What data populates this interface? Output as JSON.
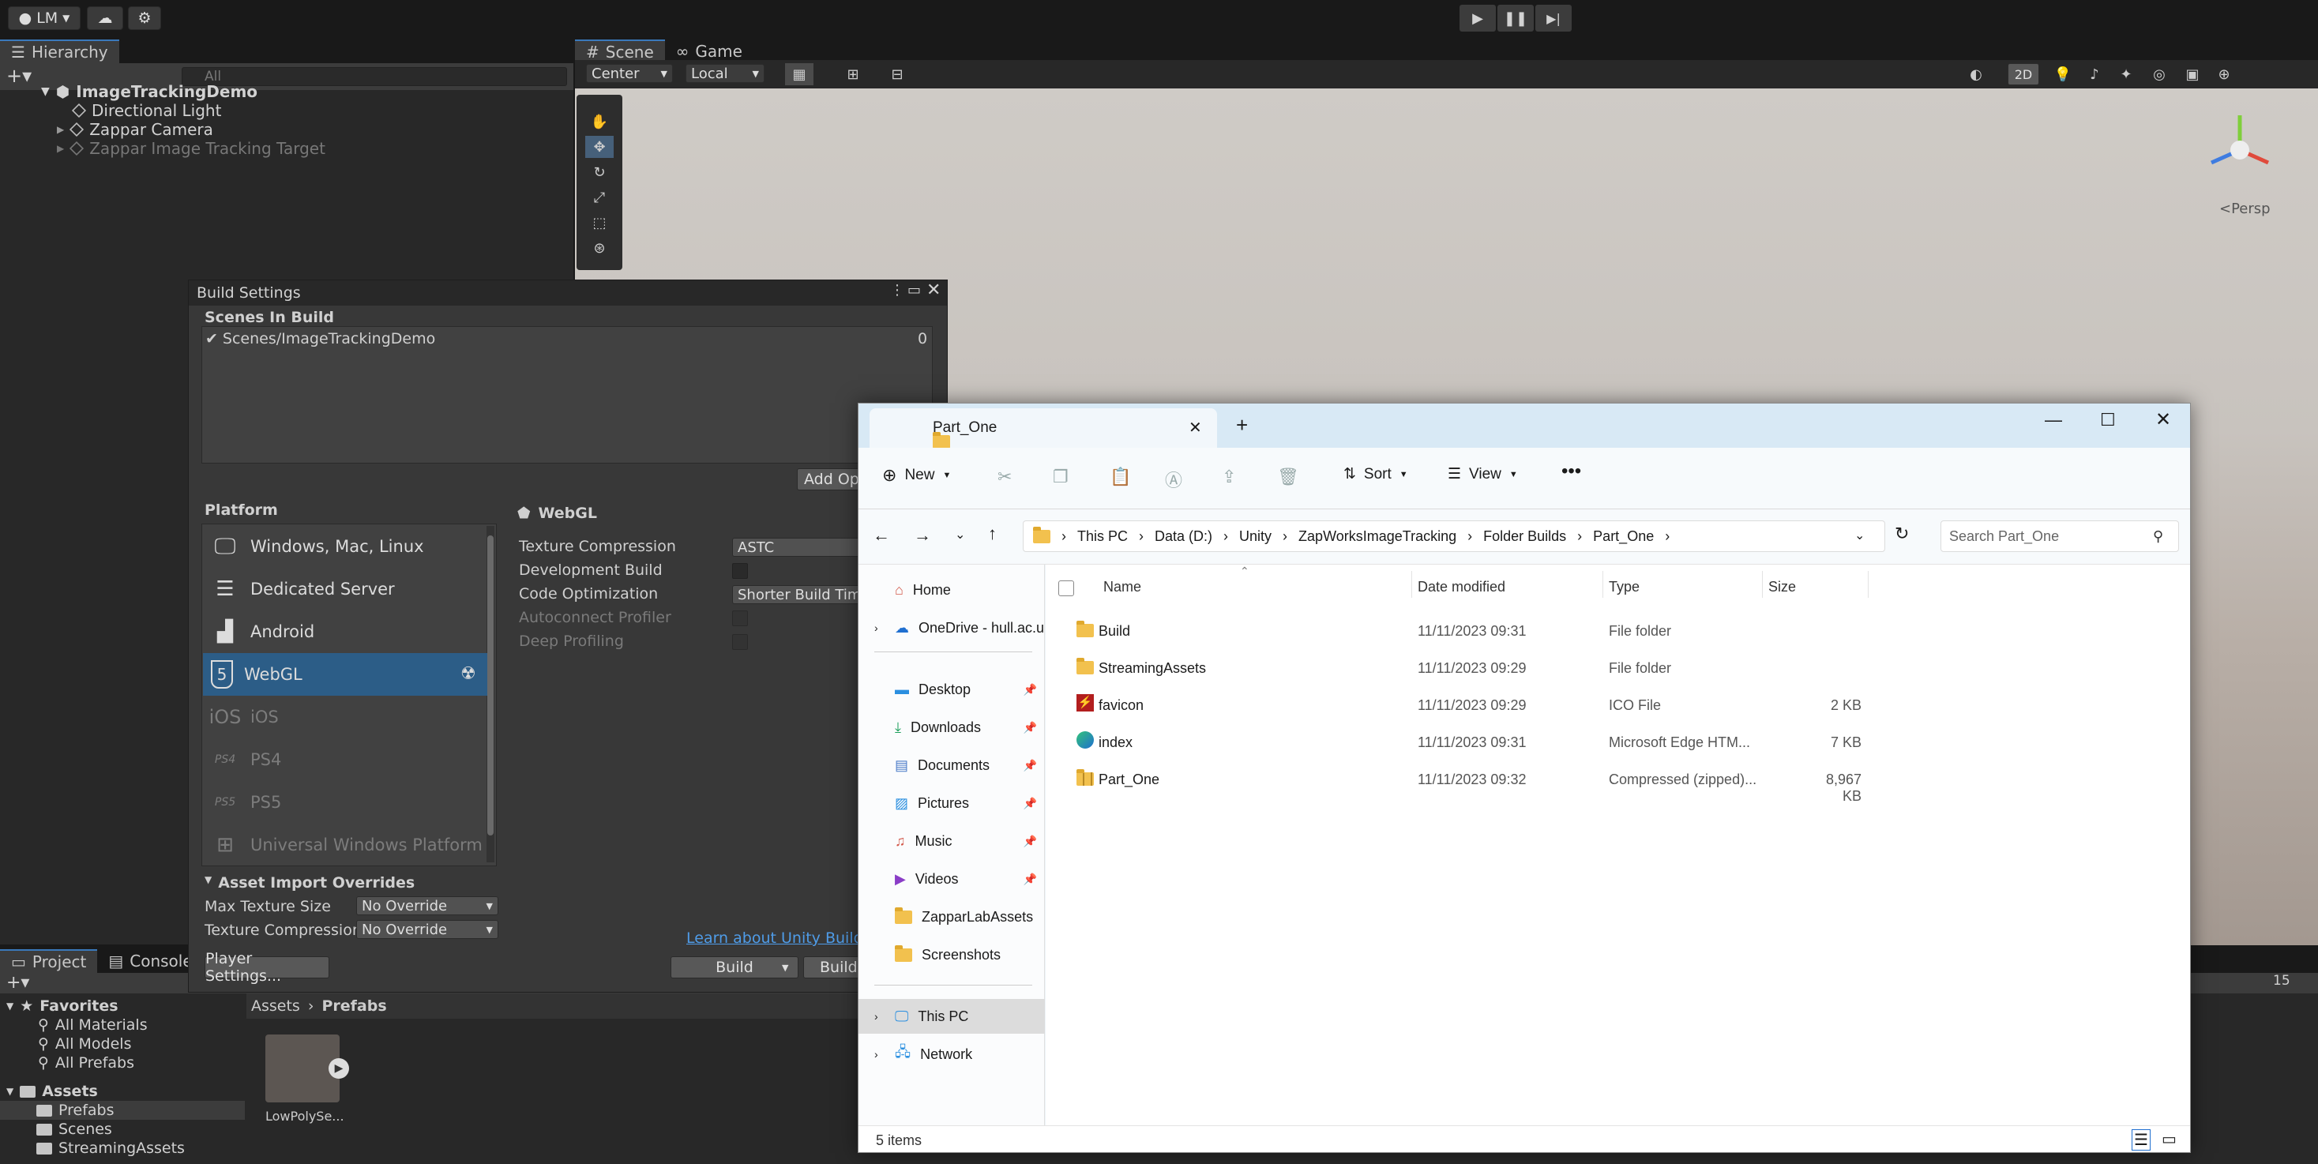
{
  "toolbar": {
    "account": "LM"
  },
  "hierarchy": {
    "tab": "Hierarchy",
    "search_placeholder": "All",
    "root": "ImageTrackingDemo",
    "items": [
      "Directional Light",
      "Zappar Camera",
      "Zappar Image Tracking Target"
    ]
  },
  "scene": {
    "tabs": [
      "Scene",
      "Game"
    ],
    "pivot": "Center",
    "space": "Local",
    "mode_2d": "2D",
    "persp": "<Persp"
  },
  "build_settings": {
    "title": "Build Settings",
    "scenes_header": "Scenes In Build",
    "scene_entry": "Scenes/ImageTrackingDemo",
    "scene_index": "0",
    "add_open": "Add Ope",
    "platform_header": "Platform",
    "platforms": [
      {
        "label": "Windows, Mac, Linux",
        "icon": "monitor-icon"
      },
      {
        "label": "Dedicated Server",
        "icon": "server-icon"
      },
      {
        "label": "Android",
        "icon": "android-icon"
      },
      {
        "label": "WebGL",
        "icon": "html5-icon"
      },
      {
        "label": "iOS",
        "icon": "ios-icon"
      },
      {
        "label": "PS4",
        "icon": "ps4-icon"
      },
      {
        "label": "PS5",
        "icon": "ps5-icon"
      },
      {
        "label": "Universal Windows Platform",
        "icon": "windows-icon"
      }
    ],
    "webgl_header": "WebGL",
    "settings": [
      {
        "label": "Texture Compression",
        "value": "ASTC"
      },
      {
        "label": "Development Build",
        "value": ""
      },
      {
        "label": "Code Optimization",
        "value": "Shorter Build Time"
      },
      {
        "label": "Autoconnect Profiler",
        "value": ""
      },
      {
        "label": "Deep Profiling",
        "value": ""
      }
    ],
    "overrides_header": "Asset Import Overrides",
    "max_texture_label": "Max Texture Size",
    "max_texture_value": "No Override",
    "tex_comp_label": "Texture Compression",
    "tex_comp_value": "No Override",
    "learn_link": "Learn about Unity Build A",
    "player_settings": "Player Settings...",
    "build": "Build",
    "build_and_run": "Build"
  },
  "project": {
    "tabs": [
      "Project",
      "Console"
    ],
    "favorites": "Favorites",
    "fav_items": [
      "All Materials",
      "All Models",
      "All Prefabs"
    ],
    "assets": "Assets",
    "asset_items": [
      "Prefabs",
      "Scenes",
      "StreamingAssets"
    ],
    "breadcrumb": [
      "Assets",
      "Prefabs"
    ],
    "prefab_name": "LowPolySe...",
    "hidden_count": "15"
  },
  "explorer": {
    "tab_title": "Part_One",
    "new": "New",
    "sort": "Sort",
    "view": "View",
    "breadcrumb": [
      "This PC",
      "Data (D:)",
      "Unity",
      "ZapWorksImageTracking",
      "Folder Builds",
      "Part_One"
    ],
    "search_placeholder": "Search Part_One",
    "sidebar": {
      "home": "Home",
      "onedrive": "OneDrive - hull.ac.u",
      "quick": [
        "Desktop",
        "Downloads",
        "Documents",
        "Pictures",
        "Music",
        "Videos",
        "ZapparLabAssets",
        "Screenshots"
      ],
      "this_pc": "This PC",
      "network": "Network"
    },
    "columns": [
      "Name",
      "Date modified",
      "Type",
      "Size"
    ],
    "files": [
      {
        "name": "Build",
        "date": "11/11/2023 09:31",
        "type": "File folder",
        "size": "",
        "icon": "folder-icon"
      },
      {
        "name": "StreamingAssets",
        "date": "11/11/2023 09:29",
        "type": "File folder",
        "size": "",
        "icon": "folder-icon"
      },
      {
        "name": "favicon",
        "date": "11/11/2023 09:29",
        "type": "ICO File",
        "size": "2 KB",
        "icon": "ico-file-icon"
      },
      {
        "name": "index",
        "date": "11/11/2023 09:31",
        "type": "Microsoft Edge HTM...",
        "size": "7 KB",
        "icon": "edge-icon"
      },
      {
        "name": "Part_One",
        "date": "11/11/2023 09:32",
        "type": "Compressed (zipped)...",
        "size": "8,967 KB",
        "icon": "zip-folder-icon"
      }
    ],
    "status": "5 items"
  }
}
